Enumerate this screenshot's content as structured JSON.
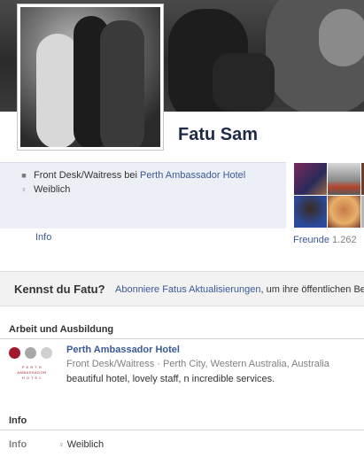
{
  "profile": {
    "name": "Fatu Sam"
  },
  "intro": {
    "work_prefix": "Front Desk/Waitress bei ",
    "work_place": "Perth Ambassador Hotel",
    "gender": "Weiblich",
    "work_icon": "briefcase-icon",
    "gender_icon": "person-icon"
  },
  "tabs": {
    "info": "Info"
  },
  "friends": {
    "label": "Freunde",
    "count": "1.262"
  },
  "know_banner": {
    "title": "Kennst du Fatu?",
    "link": "Abonniere Fatus Aktualisierungen",
    "rest": ", um ihre öffentlichen Beit"
  },
  "work_section": {
    "title": "Arbeit und Ausbildung",
    "employer": "Perth Ambassador Hotel",
    "position_location": "Front Desk/Waitress · Perth City, Western Australia, Australia",
    "description": "beautiful hotel, lovely staff, n incredible services.",
    "logo_text_1": "P E R T H",
    "logo_text_2": "AMBASSADOR",
    "logo_text_3": "H O T E L"
  },
  "info_section": {
    "title": "Info",
    "row_label": "Info",
    "row_value": "Weiblich"
  },
  "colors": {
    "link": "#3b5998",
    "logo_red": "#a0192d",
    "panel_bg": "#eceff5"
  }
}
